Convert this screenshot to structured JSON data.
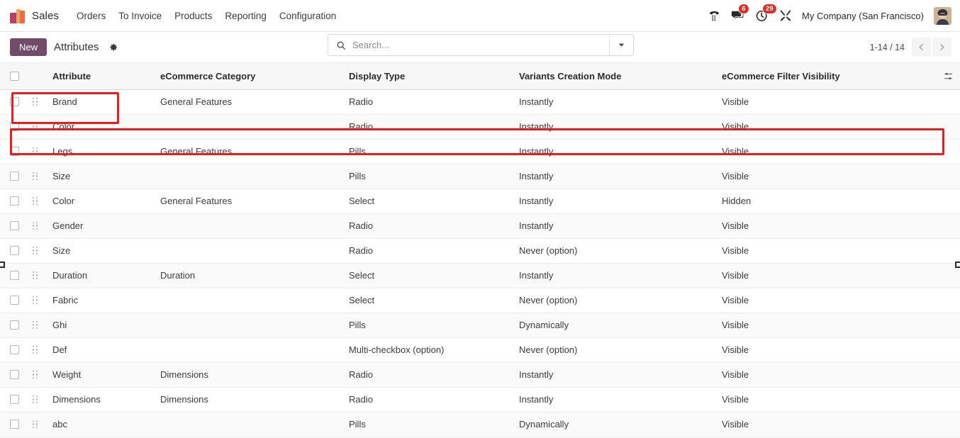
{
  "navbar": {
    "app_logo_icon": "sales-app-icon",
    "app_name": "Sales",
    "menu_items": [
      {
        "label": "Orders"
      },
      {
        "label": "To Invoice"
      },
      {
        "label": "Products"
      },
      {
        "label": "Reporting"
      },
      {
        "label": "Configuration"
      }
    ],
    "icons": [
      {
        "name": "voip-dialpad-icon",
        "badge": null
      },
      {
        "name": "messaging-chat-icon",
        "badge": "6"
      },
      {
        "name": "activities-clock-icon",
        "badge": "29"
      },
      {
        "name": "debug-tools-icon",
        "badge": null
      }
    ],
    "company": "My Company (San Francisco)",
    "avatar_name": "user-avatar"
  },
  "control_panel": {
    "new_label": "New",
    "breadcrumb": "Attributes",
    "gear_icon": "gear-icon",
    "search": {
      "placeholder": "Search...",
      "value": "",
      "search_icon": "search-icon",
      "toggle_icon": "chevron-down-icon"
    },
    "pager": {
      "count": "1-14 / 14",
      "prev_icon": "chevron-left-icon",
      "next_icon": "chevron-right-icon"
    }
  },
  "table": {
    "select_all_name": "select-all-checkbox",
    "options_icon": "column-options-icon",
    "columns": [
      "Attribute",
      "eCommerce Category",
      "Display Type",
      "Variants Creation Mode",
      "eCommerce Filter Visibility"
    ],
    "rows": [
      {
        "attribute": "Brand",
        "ecommerce_category": "General Features",
        "display_type": "Radio",
        "variants_creation_mode": "Instantly",
        "filter_visibility": "Visible"
      },
      {
        "attribute": "Color",
        "ecommerce_category": "",
        "display_type": "Radio",
        "variants_creation_mode": "Instantly",
        "filter_visibility": "Visible"
      },
      {
        "attribute": "Legs",
        "ecommerce_category": "General Features",
        "display_type": "Pills",
        "variants_creation_mode": "Instantly",
        "filter_visibility": "Visible"
      },
      {
        "attribute": "Size",
        "ecommerce_category": "",
        "display_type": "Pills",
        "variants_creation_mode": "Instantly",
        "filter_visibility": "Visible"
      },
      {
        "attribute": "Color",
        "ecommerce_category": "General Features",
        "display_type": "Select",
        "variants_creation_mode": "Instantly",
        "filter_visibility": "Hidden"
      },
      {
        "attribute": "Gender",
        "ecommerce_category": "",
        "display_type": "Radio",
        "variants_creation_mode": "Instantly",
        "filter_visibility": "Visible"
      },
      {
        "attribute": "Size",
        "ecommerce_category": "",
        "display_type": "Radio",
        "variants_creation_mode": "Never (option)",
        "filter_visibility": "Visible"
      },
      {
        "attribute": "Duration",
        "ecommerce_category": "Duration",
        "display_type": "Select",
        "variants_creation_mode": "Instantly",
        "filter_visibility": "Visible"
      },
      {
        "attribute": "Fabric",
        "ecommerce_category": "",
        "display_type": "Select",
        "variants_creation_mode": "Never (option)",
        "filter_visibility": "Visible"
      },
      {
        "attribute": "Ghi",
        "ecommerce_category": "",
        "display_type": "Pills",
        "variants_creation_mode": "Dynamically",
        "filter_visibility": "Visible"
      },
      {
        "attribute": "Def",
        "ecommerce_category": "",
        "display_type": "Multi-checkbox (option)",
        "variants_creation_mode": "Never (option)",
        "filter_visibility": "Visible"
      },
      {
        "attribute": "Weight",
        "ecommerce_category": "Dimensions",
        "display_type": "Radio",
        "variants_creation_mode": "Instantly",
        "filter_visibility": "Visible"
      },
      {
        "attribute": "Dimensions",
        "ecommerce_category": "Dimensions",
        "display_type": "Radio",
        "variants_creation_mode": "Instantly",
        "filter_visibility": "Visible"
      },
      {
        "attribute": "abc",
        "ecommerce_category": "",
        "display_type": "Pills",
        "variants_creation_mode": "Dynamically",
        "filter_visibility": "Visible"
      }
    ]
  },
  "annotations": {
    "accent_color": "#e81d1d",
    "boxes": [
      {
        "name": "new-button-highlight"
      },
      {
        "name": "table-header-highlight"
      }
    ]
  }
}
